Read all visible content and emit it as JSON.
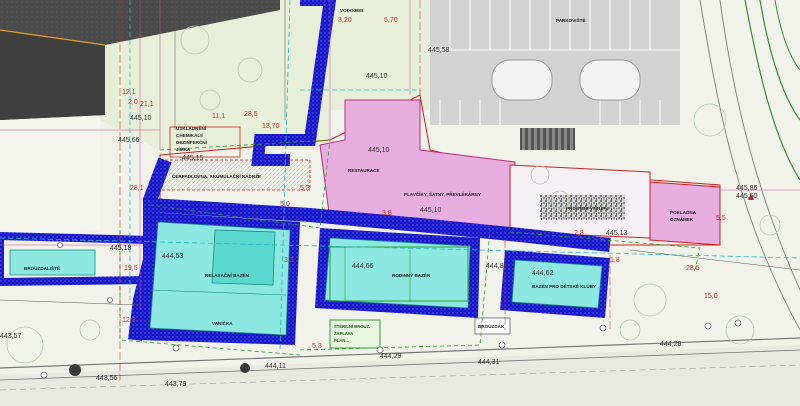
{
  "map": {
    "rooms": {
      "vodojem": "VODOJEM",
      "parkoviste": "PARKOVIŠTĚ",
      "uskladneni": [
        "USKLADNĚNÍ",
        "CHEMIKÁLIÍ",
        "DEZINFEKČNÍ",
        "JÍMKA"
      ],
      "cerpadlo": "ČERPADLOVNA, AKUMULAČNÍ NÁDRŽE",
      "restaurace": "RESTAURACE",
      "satny": "PLAVČÍKY, ŠATNY, PŘEVLÉKÁRNY",
      "vstup": "PROSTOR VSTUPU",
      "pokladna": [
        "POKLADNA",
        "OZNÁMEK"
      ],
      "brouzdaliste": "BROUZDALIŠTĚ",
      "relaxacni": "RELAXAČNÍ BAZÉN",
      "vanicka": "VANIČKA",
      "rodinny": "RODINNÝ BAZÉN",
      "detsky": "BAZÉN PRO DĚTSKÉ KLUBY",
      "sterilni": [
        "STERILNÍ BROUZ.",
        "ZÁPLAVA",
        "PLÁN..."
      ],
      "brouzd2": "BROUZDÁK"
    },
    "elevations": {
      "e1": "445,58",
      "e2": "445,10",
      "e3": "445,10",
      "e4": "445,10",
      "e5": "445,15",
      "e6": "444,53",
      "e7": "444,66",
      "e8": "444,62",
      "e9": "445,18",
      "e10": "445,13",
      "e11": "443,57",
      "e12": "444,29",
      "e13": "444,31",
      "e14": "444,28",
      "e15": "443,79",
      "e16": "443,56",
      "e17": "445,66",
      "e18": "445,86",
      "e19": "445,50",
      "e20": "444,11",
      "e21": "445,10",
      "e22": "444,86"
    },
    "dimensions": {
      "d1": "3,20",
      "d2": "5,70",
      "d3": "11,1",
      "d4": "13,70",
      "d5": "28,5",
      "d6": "12,1",
      "d7": "2,0",
      "d8": "28,1",
      "d9": "21,1",
      "d10": "5,3",
      "d11": "3,8",
      "d12": "2,8",
      "d13": "15,0",
      "d14": "28,5",
      "d15": "5,3",
      "d16": "12,3",
      "d17": "19,5",
      "d18": "1,8",
      "d19": "3,3",
      "d20": "5,0",
      "d21": "5,5"
    }
  }
}
